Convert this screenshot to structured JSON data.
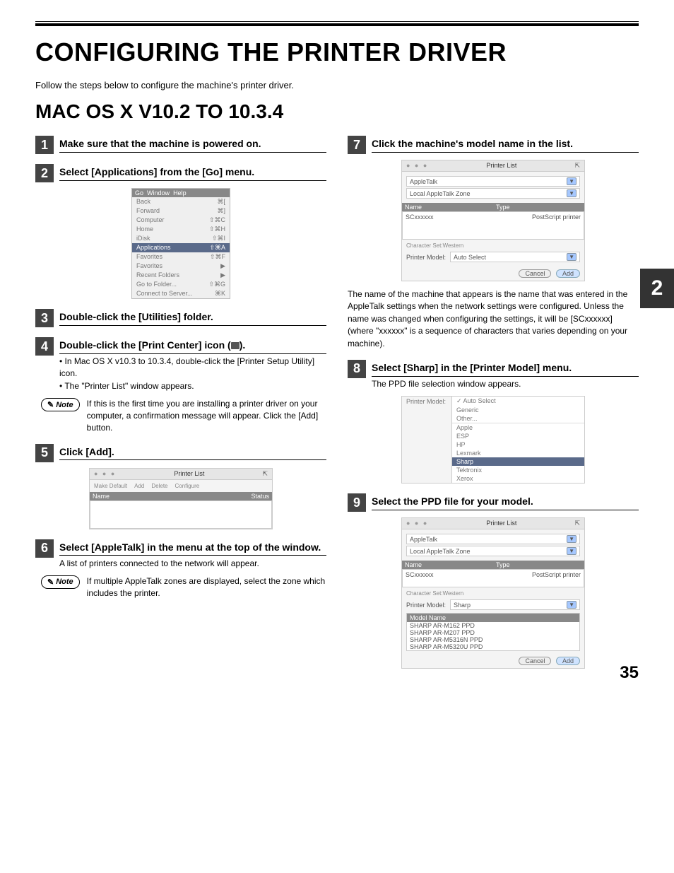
{
  "page": {
    "title": "CONFIGURING THE PRINTER DRIVER",
    "intro": "Follow the steps below to configure the machine's printer driver.",
    "subtitle": "MAC OS X V10.2 TO 10.3.4",
    "page_number": "35",
    "side_tab": "2"
  },
  "left": {
    "step1": {
      "num": "1",
      "title": "Make sure that the machine is powered on."
    },
    "step2": {
      "num": "2",
      "title": "Select [Applications] from the [Go] menu.",
      "menu": {
        "header_left": "Go",
        "header_mid": "Window",
        "header_right": "Help",
        "items": [
          {
            "label": "Back",
            "shortcut": "⌘["
          },
          {
            "label": "Forward",
            "shortcut": "⌘]"
          },
          {
            "label": "Computer",
            "shortcut": "⇧⌘C"
          },
          {
            "label": "Home",
            "shortcut": "⇧⌘H"
          },
          {
            "label": "iDisk",
            "shortcut": "⇧⌘I"
          },
          {
            "label": "Applications",
            "shortcut": "⇧⌘A",
            "highlight": true
          },
          {
            "label": "Favorites",
            "shortcut": "⇧⌘F"
          },
          {
            "label": "Favorites",
            "shortcut": "▶"
          },
          {
            "label": "Recent Folders",
            "shortcut": "▶"
          },
          {
            "label": "Go to Folder...",
            "shortcut": "⇧⌘G"
          },
          {
            "label": "Connect to Server...",
            "shortcut": "⌘K"
          }
        ]
      }
    },
    "step3": {
      "num": "3",
      "title": "Double-click the [Utilities] folder."
    },
    "step4": {
      "num": "4",
      "title_a": "Double-click the [Print Center] icon (",
      "title_b": ").",
      "bullets": [
        "In Mac OS X v10.3 to 10.3.4, double-click the [Printer Setup Utility] icon.",
        "The \"Printer List\" window appears."
      ],
      "note": "If this is the first time you are installing a printer driver on your computer, a confirmation message will appear. Click the [Add] button."
    },
    "step5": {
      "num": "5",
      "title": "Click [Add].",
      "shot": {
        "title": "Printer List",
        "toolbar": [
          "Make Default",
          "Add",
          "Delete",
          "Configure"
        ],
        "col_name": "Name",
        "col_status": "Status"
      }
    },
    "step6": {
      "num": "6",
      "title": "Select [AppleTalk] in the menu at the top of the window.",
      "body": "A list of printers connected to the network will appear.",
      "note": "If multiple AppleTalk zones are displayed, select the zone which includes the printer."
    }
  },
  "right": {
    "step7": {
      "num": "7",
      "title": "Click the machine's model name in the list.",
      "shot": {
        "title": "Printer List",
        "menu1": "AppleTalk",
        "menu2": "Local AppleTalk Zone",
        "col_name": "Name",
        "col_type": "Type",
        "row_name": "SCxxxxxx",
        "row_type": "PostScript printer",
        "char_set": "Character Set:Western",
        "pm_label": "Printer Model:",
        "pm_value": "Auto Select",
        "cancel": "Cancel",
        "add": "Add"
      },
      "paragraph": "The name of the machine that appears is the name that was entered in the AppleTalk settings when the network settings were configured. Unless the name was changed when configuring the settings, it will be [SCxxxxxx] (where \"xxxxxx\" is a sequence of characters that varies depending on your machine)."
    },
    "step8": {
      "num": "8",
      "title": "Select [Sharp] in the [Printer Model] menu.",
      "body": "The PPD file selection window appears.",
      "shot": {
        "label": "Printer Model:",
        "options": [
          "Auto Select",
          "Generic",
          "Other...",
          "Apple",
          "ESP",
          "HP",
          "Lexmark",
          "Sharp",
          "Tektronix",
          "Xerox"
        ],
        "checked": "Auto Select",
        "selected": "Sharp"
      }
    },
    "step9": {
      "num": "9",
      "title": "Select the PPD file for your model.",
      "shot": {
        "title": "Printer List",
        "menu1": "AppleTalk",
        "menu2": "Local AppleTalk Zone",
        "col_name": "Name",
        "col_type": "Type",
        "row_name": "SCxxxxxx",
        "row_type": "PostScript printer",
        "char_set": "Character Set:Western",
        "pm_label": "Printer Model:",
        "pm_value": "Sharp",
        "model_header": "Model Name",
        "models": [
          "SHARP AR-M162 PPD",
          "SHARP AR-M207 PPD",
          "SHARP AR-M5316N PPD",
          "SHARP AR-M5320U PPD"
        ],
        "cancel": "Cancel",
        "add": "Add"
      }
    }
  },
  "note_label": "Note"
}
